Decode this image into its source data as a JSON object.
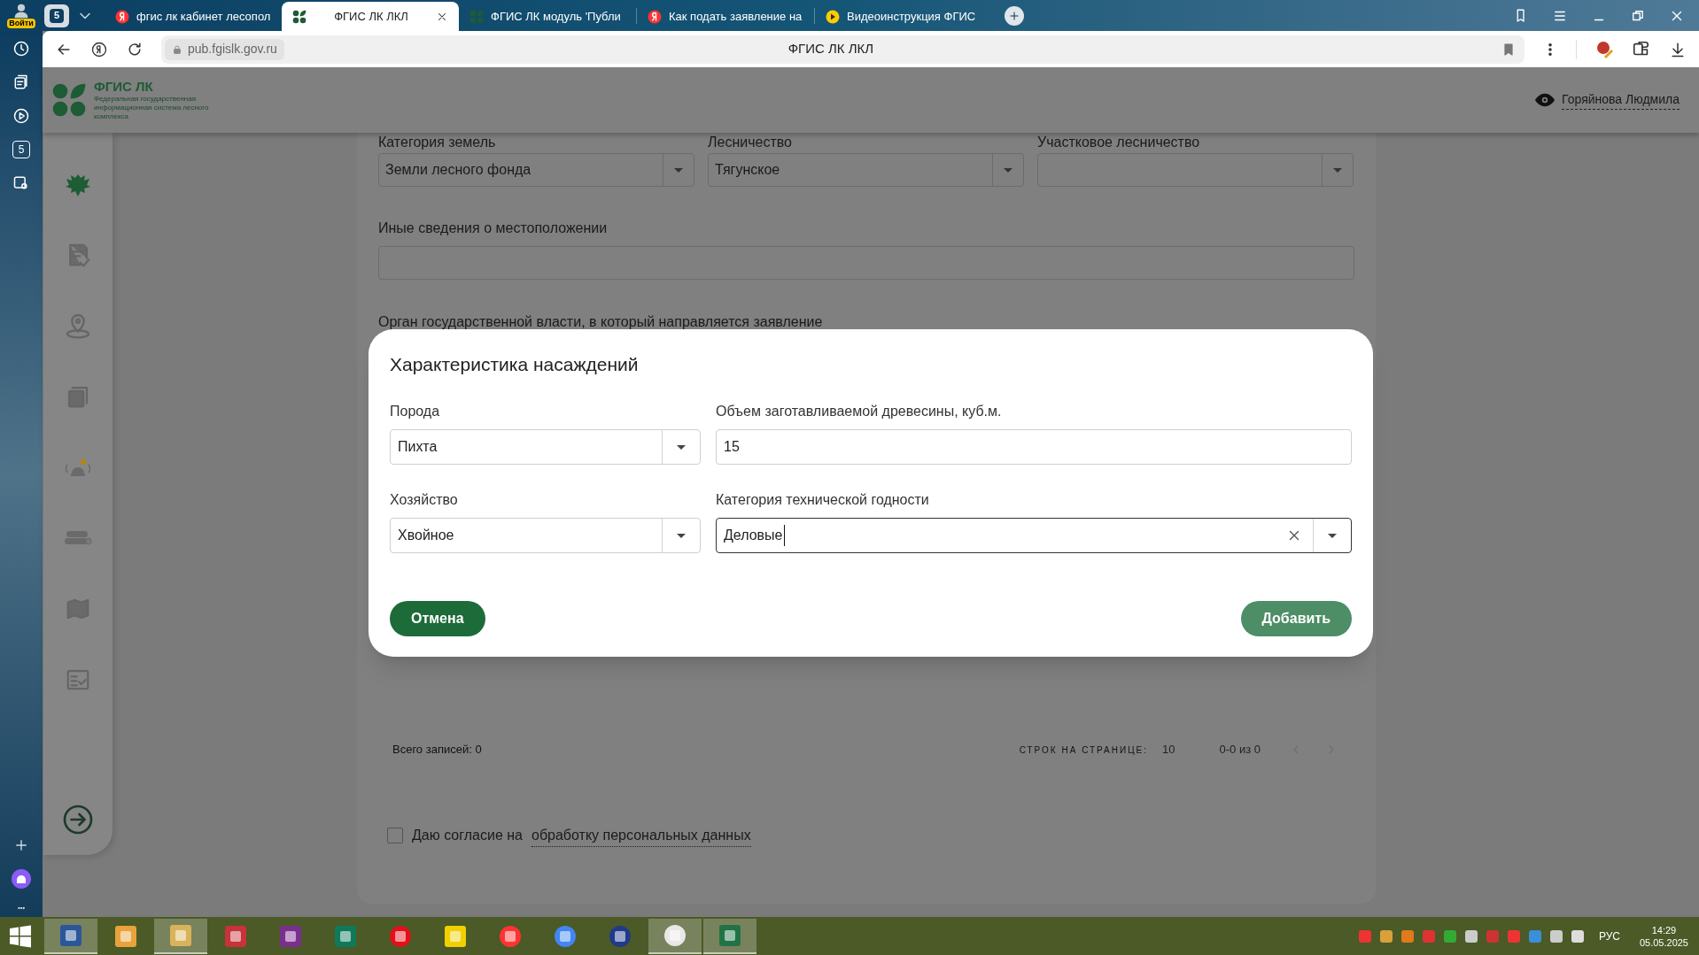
{
  "browser": {
    "login_label": "Войти",
    "tab_count": "5",
    "tabs": [
      {
        "title": "фгис лк кабинет лесопол",
        "kind": "yandex",
        "selected": false
      },
      {
        "title": "ФГИС ЛК ЛКЛ",
        "kind": "fgis",
        "selected": true
      },
      {
        "title": "ФГИС ЛК модуль 'Публи",
        "kind": "fgis",
        "selected": false
      },
      {
        "title": "Как подать заявление на",
        "kind": "yandex",
        "selected": false
      },
      {
        "title": "Видеоинструкция ФГИС",
        "kind": "video",
        "selected": false
      }
    ],
    "url": "pub.fgislk.gov.ru",
    "page_title": "ФГИС ЛК ЛКЛ",
    "sidebar_badge": "5"
  },
  "header": {
    "logo_title": "ФГИС ЛК",
    "logo_subtitle": "Федеральная государственная информационная система лесного комплекса",
    "user": "Горяйнова Людмила"
  },
  "form": {
    "fields": [
      {
        "label": "Категория земель",
        "value": "Земли лесного фонда"
      },
      {
        "label": "Лесничество",
        "value": "Тягунское"
      },
      {
        "label": "Участковое лесничество"
      }
    ],
    "other_info_label": "Иные сведения о местоположении",
    "authority_label": "Орган государственной власти, в который направляется заявление"
  },
  "table": {
    "total": "Всего записей: 0",
    "rows_per_page_label": "СТРОК НА СТРАНИЦЕ:",
    "rows_per_page": "10",
    "range": "0-0 из 0"
  },
  "consent": {
    "checked": false,
    "text": "Даю согласие на",
    "link": "обработку персональных данных"
  },
  "modal": {
    "title": "Характеристика насаждений",
    "fields": [
      {
        "label": "Порода",
        "value": "Пихта",
        "kind": "select",
        "focused": false
      },
      {
        "label": "Объем заготавливаемой древесины, куб.м.",
        "value": "15",
        "kind": "input",
        "focused": false
      },
      {
        "label": "Хозяйство",
        "value": "Хвойное",
        "kind": "select",
        "focused": false
      },
      {
        "label": "Категория технической годности",
        "value": "Деловые",
        "kind": "combo",
        "focused": true
      }
    ],
    "cancel": "Отмена",
    "submit": "Добавить"
  },
  "taskbar": {
    "apps": [
      {
        "open": true
      },
      {
        "open": false
      },
      {
        "open": true
      },
      {
        "open": false
      },
      {
        "open": false
      },
      {
        "open": false
      },
      {
        "open": false
      },
      {
        "open": false
      },
      {
        "open": false
      },
      {
        "open": false
      },
      {
        "open": false
      },
      {
        "open": true
      },
      {
        "open": true
      }
    ],
    "language": "РУС",
    "time": "14:29",
    "date": "05.05.2025"
  }
}
